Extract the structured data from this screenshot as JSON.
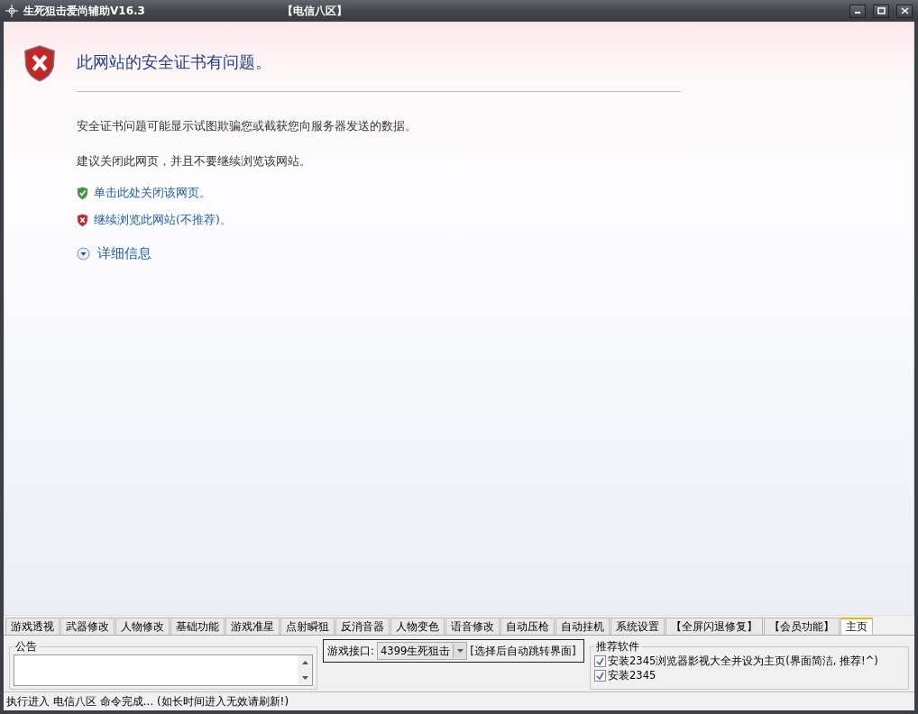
{
  "window": {
    "title": "生死狙击爱尚辅助V16.3",
    "zone": "【电信八区】"
  },
  "browser": {
    "heading": "此网站的安全证书有问题。",
    "paragraphs": [
      "安全证书问题可能显示试图欺骗您或截获您向服务器发送的数据。",
      "建议关闭此网页，并且不要继续浏览该网站。"
    ],
    "links": [
      {
        "kind": "safe",
        "label": "单击此处关闭该网页。"
      },
      {
        "kind": "unsafe",
        "label": "继续浏览此网站(不推荐)。"
      }
    ],
    "details": {
      "label": "详细信息",
      "expanded": false
    }
  },
  "tabs": [
    {
      "label": "游戏透视",
      "selected": false
    },
    {
      "label": "武器修改",
      "selected": false
    },
    {
      "label": "人物修改",
      "selected": false
    },
    {
      "label": "基础功能",
      "selected": false
    },
    {
      "label": "游戏准星",
      "selected": false
    },
    {
      "label": "点射瞬狙",
      "selected": false
    },
    {
      "label": "反消音器",
      "selected": false
    },
    {
      "label": "人物变色",
      "selected": false
    },
    {
      "label": "语音修改",
      "selected": false
    },
    {
      "label": "自动压枪",
      "selected": false
    },
    {
      "label": "自动挂机",
      "selected": false
    },
    {
      "label": "系统设置",
      "selected": false
    },
    {
      "label": "【全屏闪退修复】",
      "selected": false
    },
    {
      "label": "【会员功能】",
      "selected": false
    },
    {
      "label": "主页",
      "selected": true
    }
  ],
  "notice": {
    "title": "公告"
  },
  "game_interface": {
    "label": "游戏接口:",
    "value": "4399生死狙击",
    "hint": "[选择后自动跳转界面]"
  },
  "recommended": {
    "title": "推荐软件",
    "options": [
      {
        "label": "安装2345浏览器影视大全并设为主页(界面简洁, 推荐!^)",
        "checked": true
      },
      {
        "label": "安装2345",
        "checked": true
      }
    ]
  },
  "status_bar": "执行进入 电信八区 命令完成... (如长时间进入无效请刷新!)"
}
